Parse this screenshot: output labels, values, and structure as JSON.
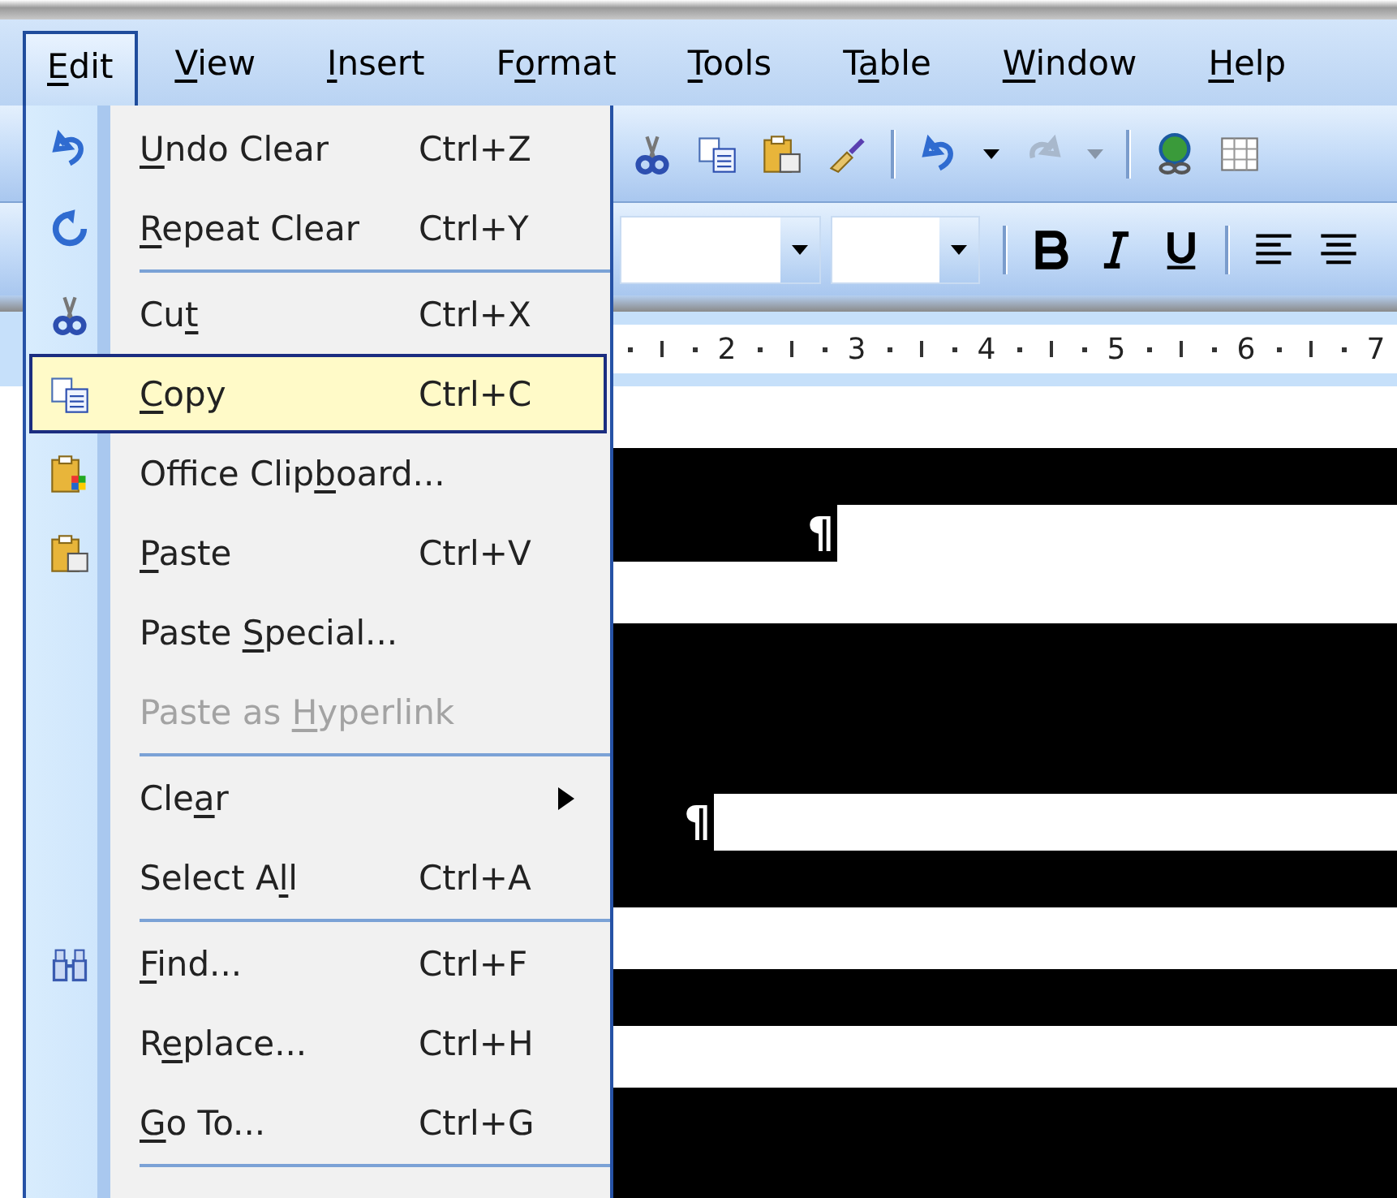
{
  "menu_bar": [
    {
      "access_key": "E",
      "text_after": "dit",
      "selected": true
    },
    {
      "access_key": "V",
      "text_after": "iew",
      "selected": false
    },
    {
      "access_key": "I",
      "text_after": "nsert",
      "selected": false
    },
    {
      "text_before": "F",
      "access_key": "o",
      "text_after": "rmat",
      "selected": false
    },
    {
      "access_key": "T",
      "text_after": "ools",
      "selected": false
    },
    {
      "text_before": "T",
      "access_key": "a",
      "text_after": "ble",
      "selected": false
    },
    {
      "access_key": "W",
      "text_after": "indow",
      "selected": false
    },
    {
      "access_key": "H",
      "text_after": "elp",
      "selected": false
    }
  ],
  "edit_menu": {
    "items": [
      {
        "kind": "command",
        "access_key": "U",
        "text_after": "ndo Clear",
        "shortcut": "Ctrl+Z",
        "disabled": false,
        "selected": false
      },
      {
        "kind": "command",
        "access_key": "R",
        "text_after": "epeat Clear",
        "shortcut": "Ctrl+Y",
        "disabled": false,
        "selected": false
      },
      {
        "kind": "separator"
      },
      {
        "kind": "command",
        "text_before": "Cu",
        "access_key": "t",
        "shortcut": "Ctrl+X",
        "disabled": false,
        "selected": false
      },
      {
        "kind": "command",
        "access_key": "C",
        "text_after": "opy",
        "shortcut": "Ctrl+C",
        "disabled": false,
        "selected": true
      },
      {
        "kind": "command",
        "text_before": "Office Clip",
        "access_key": "b",
        "text_after": "oard...",
        "disabled": false,
        "selected": false
      },
      {
        "kind": "command",
        "access_key": "P",
        "text_after": "aste",
        "shortcut": "Ctrl+V",
        "disabled": false,
        "selected": false
      },
      {
        "kind": "command",
        "text_before": "Paste ",
        "access_key": "S",
        "text_after": "pecial...",
        "disabled": false,
        "selected": false
      },
      {
        "kind": "command",
        "text_before": "Paste as ",
        "access_key": "H",
        "text_after": "yperlink",
        "disabled": true,
        "selected": false
      },
      {
        "kind": "separator"
      },
      {
        "kind": "submenu",
        "text_before": "Cle",
        "access_key": "a",
        "text_after": "r",
        "disabled": false,
        "selected": false
      },
      {
        "kind": "command",
        "text_before": "Select A",
        "access_key": "l",
        "text_after": "l",
        "shortcut": "Ctrl+A",
        "disabled": false,
        "selected": false
      },
      {
        "kind": "separator"
      },
      {
        "kind": "command",
        "access_key": "F",
        "text_after": "ind...",
        "shortcut": "Ctrl+F",
        "disabled": false,
        "selected": false
      },
      {
        "kind": "command",
        "text_before": "R",
        "access_key": "e",
        "text_after": "place...",
        "shortcut": "Ctrl+H",
        "disabled": false,
        "selected": false
      },
      {
        "kind": "command",
        "access_key": "G",
        "text_after": "o To...",
        "shortcut": "Ctrl+G",
        "disabled": false,
        "selected": false
      },
      {
        "kind": "separator"
      }
    ]
  },
  "ruler": {
    "numbers": [
      "2",
      "3",
      "4",
      "5",
      "6",
      "7"
    ]
  },
  "document": {
    "lines": [
      {
        "kind": "blank"
      },
      {
        "kind": "full"
      },
      {
        "kind": "short",
        "mark": "¶"
      },
      {
        "kind": "blank"
      },
      {
        "kind": "full"
      },
      {
        "kind": "full"
      },
      {
        "kind": "full"
      },
      {
        "kind": "tail",
        "mark": "¶"
      },
      {
        "kind": "full"
      },
      {
        "kind": "blank"
      },
      {
        "kind": "full"
      },
      {
        "kind": "blank"
      },
      {
        "kind": "full"
      },
      {
        "kind": "full"
      }
    ]
  }
}
